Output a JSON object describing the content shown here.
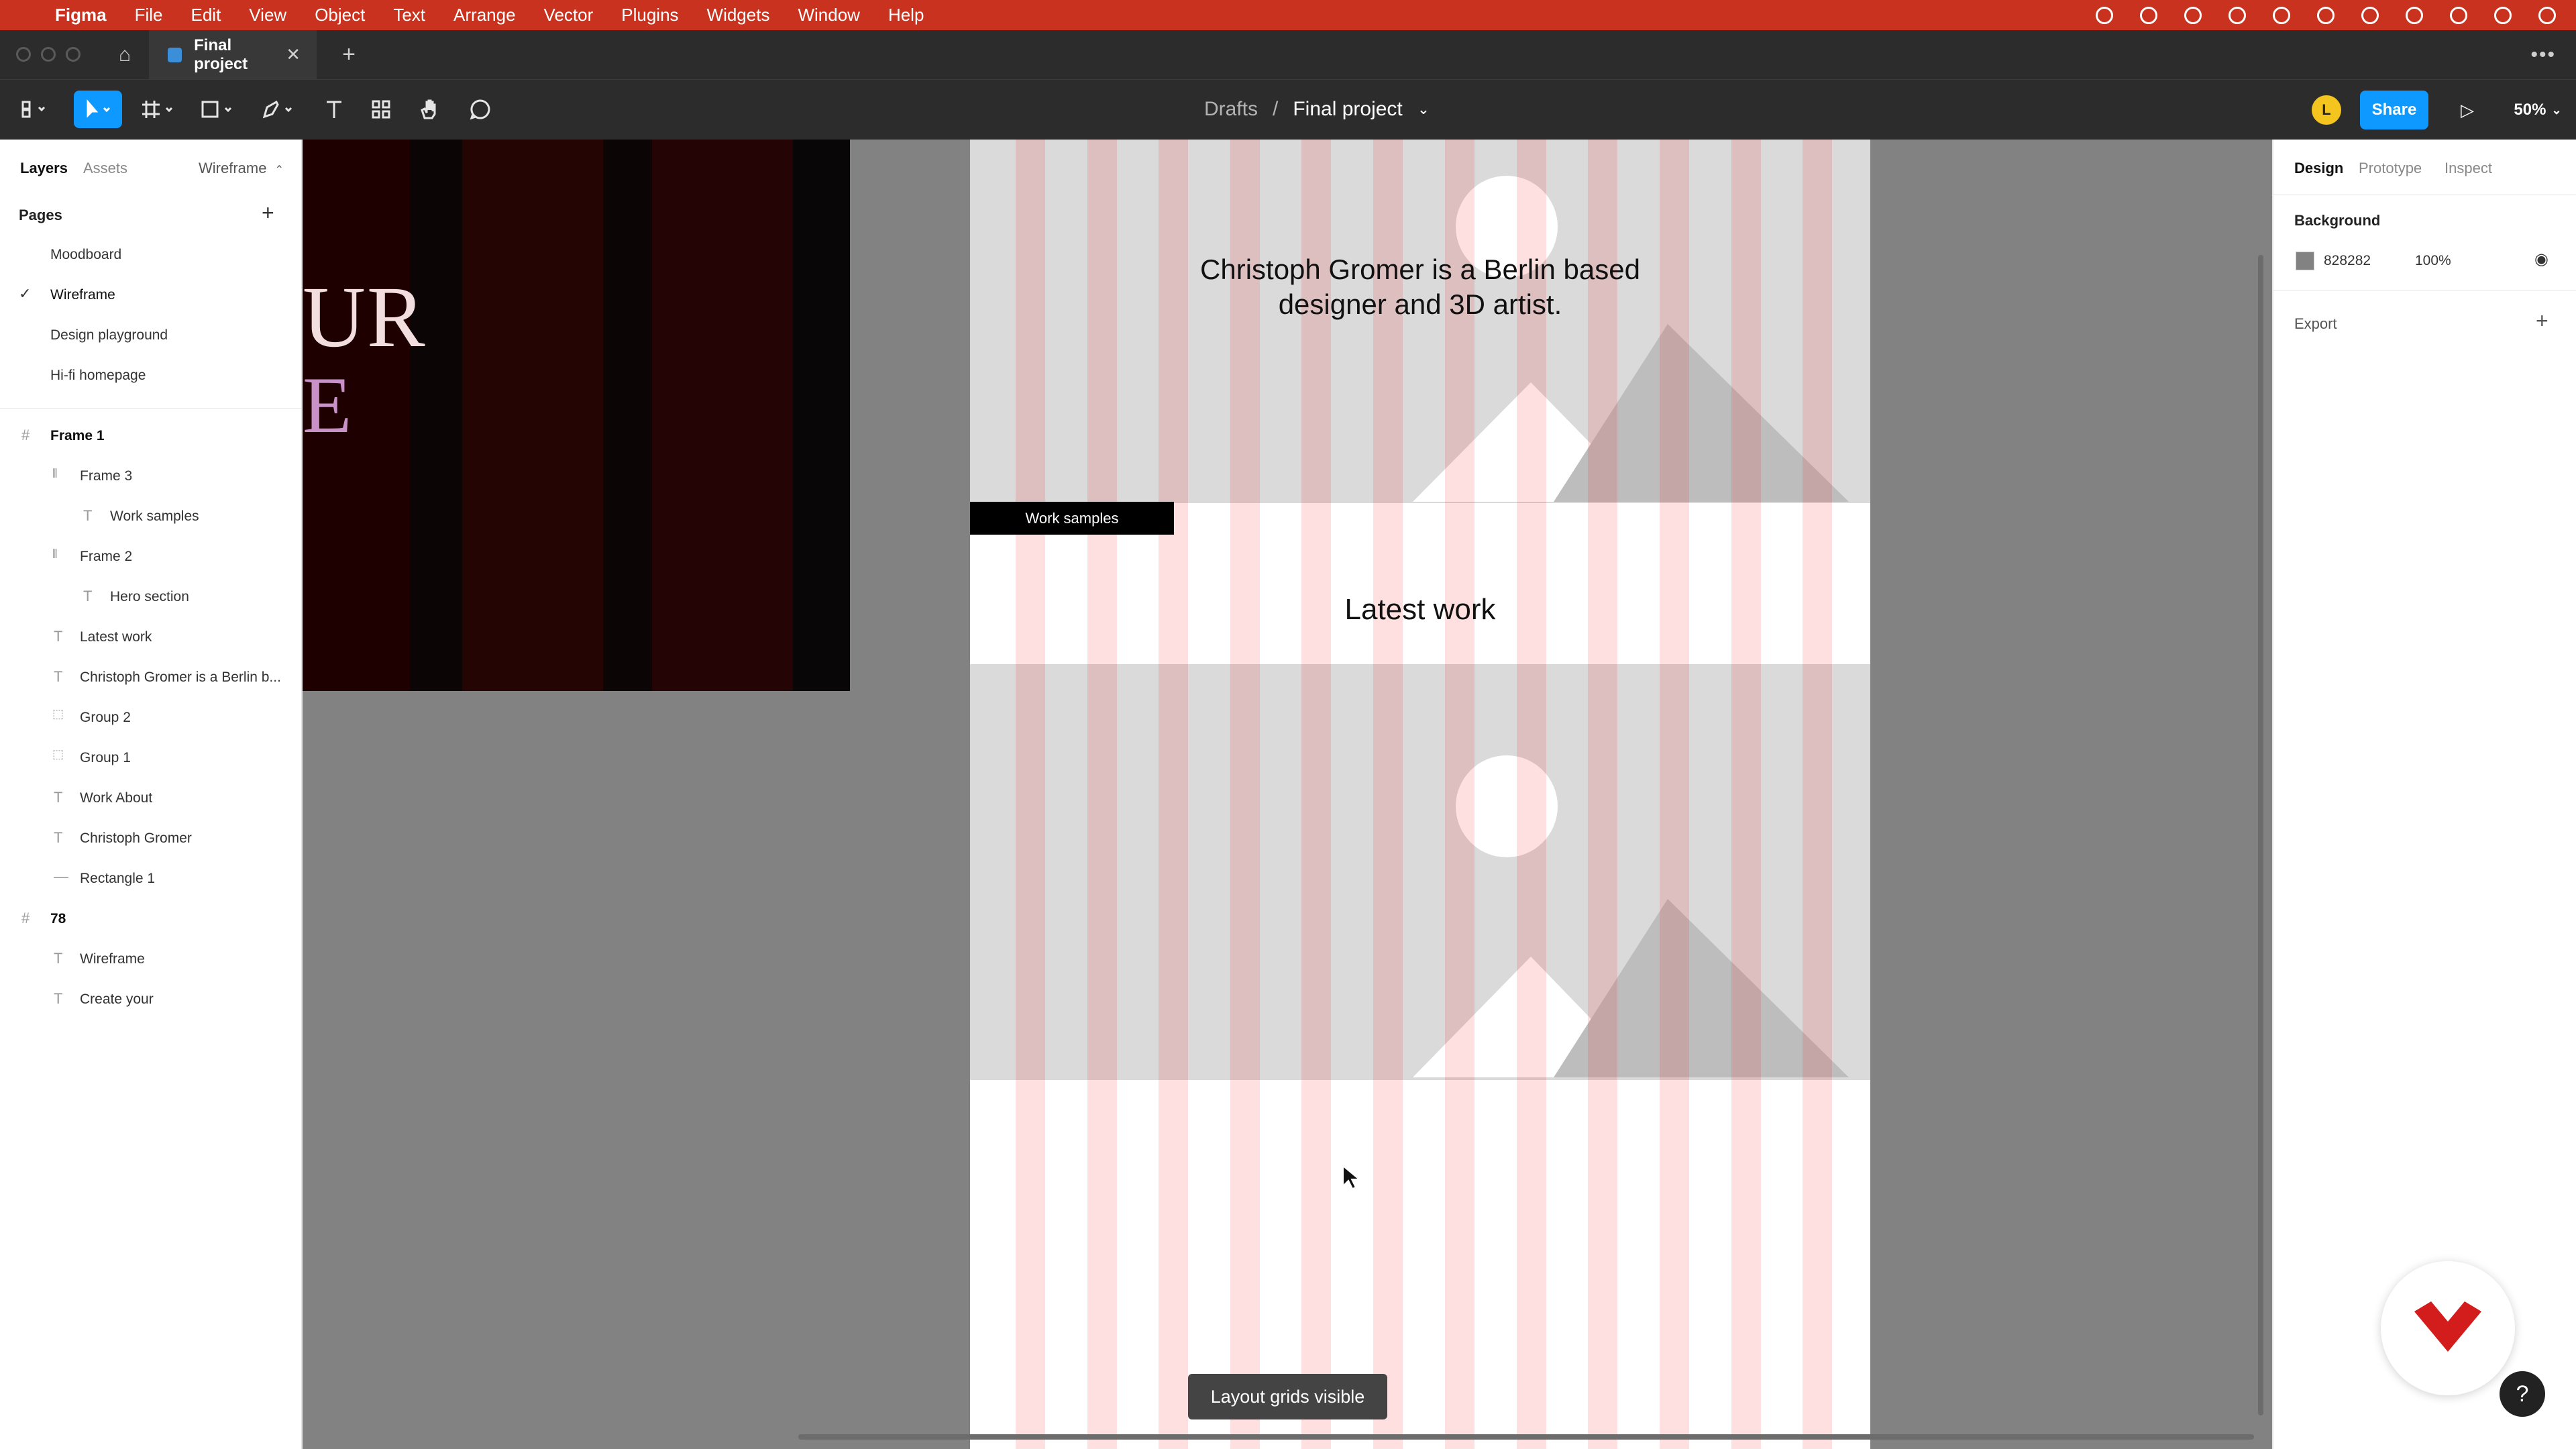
{
  "menubar": {
    "app": "Figma",
    "items": [
      "File",
      "Edit",
      "View",
      "Object",
      "Text",
      "Arrange",
      "Vector",
      "Plugins",
      "Widgets",
      "Window",
      "Help"
    ]
  },
  "tabbar": {
    "tab_title": "Final project"
  },
  "toolbar": {
    "breadcrumb_parent": "Drafts",
    "breadcrumb_separator": "/",
    "breadcrumb_current": "Final project",
    "avatar_initial": "L",
    "share_label": "Share",
    "zoom": "50%"
  },
  "left_panel": {
    "tab_layers": "Layers",
    "tab_assets": "Assets",
    "page_selector": "Wireframe",
    "pages_label": "Pages",
    "pages": [
      "Moodboard",
      "Wireframe",
      "Design playground",
      "Hi-fi homepage"
    ],
    "layers": [
      {
        "label": "Frame 1"
      },
      {
        "label": "Frame 3"
      },
      {
        "label": "Work samples"
      },
      {
        "label": "Frame 2"
      },
      {
        "label": "Hero section"
      },
      {
        "label": "Latest work"
      },
      {
        "label": "Christoph Gromer is a Berlin b..."
      },
      {
        "label": "Group 2"
      },
      {
        "label": "Group 1"
      },
      {
        "label": "Work About"
      },
      {
        "label": "Christoph Gromer"
      },
      {
        "label": "Rectangle 1"
      },
      {
        "label": "78"
      },
      {
        "label": "Wireframe"
      },
      {
        "label": "Create your"
      }
    ]
  },
  "canvas": {
    "dark_frame_text_1": "UR",
    "dark_frame_text_2": "E",
    "hero_text_line1": "Christoph Gromer is a Berlin based",
    "hero_text_line2": "designer and 3D artist.",
    "work_samples": "Work samples",
    "latest_work": "Latest work",
    "tooltip": "Layout grids visible"
  },
  "right_panel": {
    "tab_design": "Design",
    "tab_prototype": "Prototype",
    "tab_inspect": "Inspect",
    "background_label": "Background",
    "background_hex": "828282",
    "background_opacity": "100%",
    "export_label": "Export",
    "help": "?"
  },
  "colors": {
    "menubar": "#c8321e",
    "accent": "#0d99ff",
    "canvas": "#828282"
  }
}
